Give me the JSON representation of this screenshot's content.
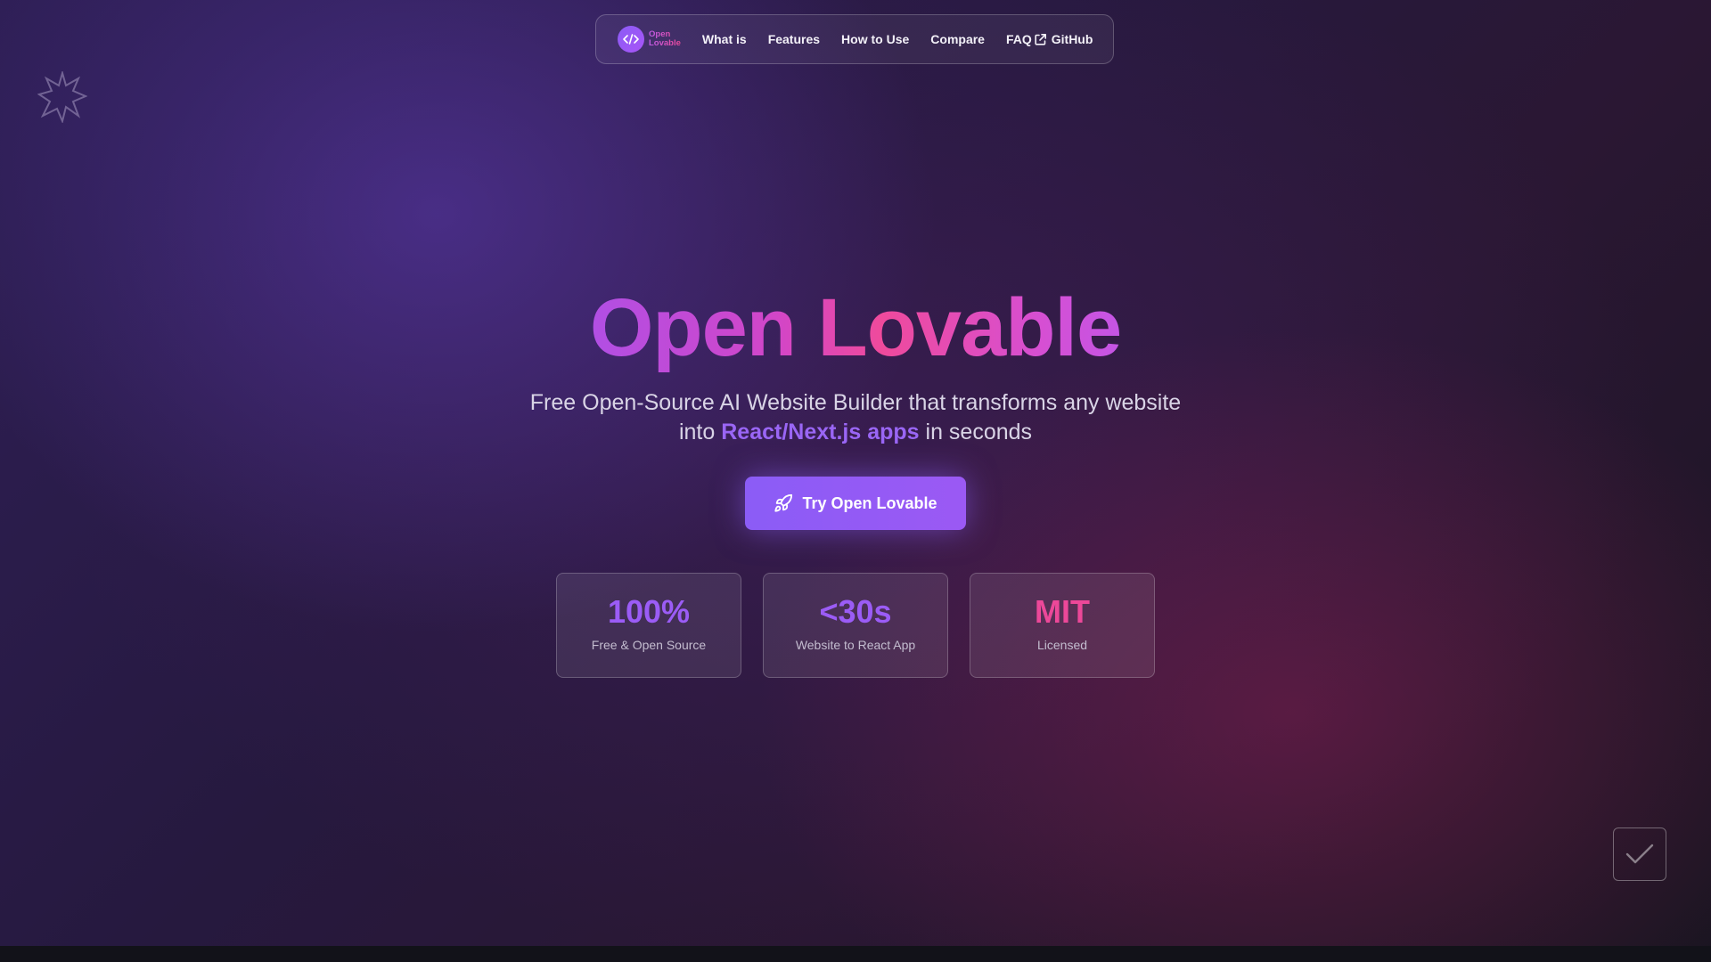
{
  "nav": {
    "logo": {
      "line1": "Open",
      "line2": "Lovable"
    },
    "links": [
      {
        "label": "What is"
      },
      {
        "label": "Features"
      },
      {
        "label": "How to Use"
      },
      {
        "label": "Compare"
      },
      {
        "label": "FAQ"
      },
      {
        "label": "GitHub"
      }
    ]
  },
  "hero": {
    "title": "Open Lovable",
    "subtitle_line1": "Free Open-Source AI Website Builder that transforms any website",
    "subtitle_line2_before": "into ",
    "subtitle_highlight": "React/Next.js apps",
    "subtitle_line2_after": " in seconds",
    "cta_label": "Try Open Lovable"
  },
  "stats": [
    {
      "value": "100%",
      "label": "Free & Open Source"
    },
    {
      "value": "<30s",
      "label": "Website to React App"
    },
    {
      "value": "MIT",
      "label": "Licensed"
    }
  ],
  "colors": {
    "accent_purple": "#8b5cf6",
    "accent_pink": "#ec4899",
    "highlight": "#9a66f5"
  },
  "icons": {
    "logo": "code-brackets-icon",
    "external": "external-link-icon",
    "cta": "rocket-icon",
    "decor": "star-burst-icon",
    "corner": "checkmark-icon"
  }
}
